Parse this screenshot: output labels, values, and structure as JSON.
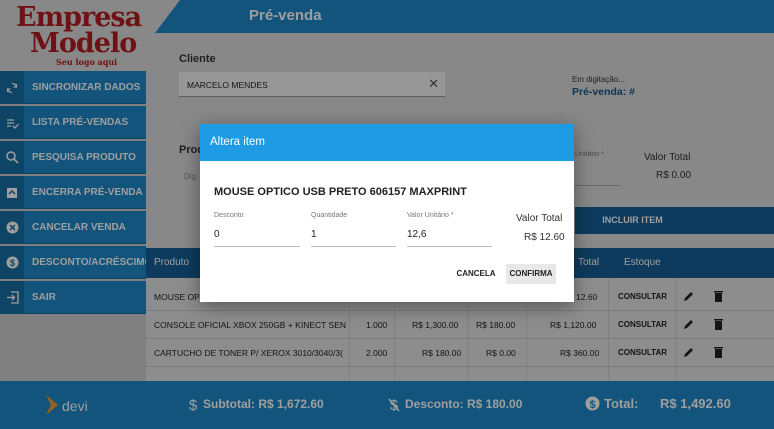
{
  "logo": {
    "line1": "Empresa",
    "line2": "Modelo",
    "tagline": "Seu logo aqui"
  },
  "header": {
    "title": "Pré-venda"
  },
  "sidebar": {
    "items": [
      {
        "label": "SINCRONIZAR DADOS",
        "icon": "sync-icon"
      },
      {
        "label": "LISTA PRÉ-VENDAS",
        "icon": "list-check-icon"
      },
      {
        "label": "PESQUISA PRODUTO",
        "icon": "search-icon"
      },
      {
        "label": "ENCERRA PRÉ-VENDA",
        "icon": "close-sale-icon"
      },
      {
        "label": "CANCELAR VENDA",
        "icon": "cancel-circle-icon"
      },
      {
        "label": "DESCONTO/ACRÉSCIMO",
        "icon": "dollar-circle-icon"
      },
      {
        "label": "SAIR",
        "icon": "exit-icon"
      }
    ]
  },
  "form": {
    "cliente_label": "Cliente",
    "cliente_value": "MARCELO MENDES",
    "status_text": "Em digitação...",
    "pre_venda_label": "Pré-venda: #",
    "produto_label": "Prod",
    "produto_placeholder": "Dig",
    "valor_unitario_label": "Unitário *",
    "valor_total_label": "Valor Total",
    "valor_total_value": "R$ 0.00",
    "incluir_label": "INCLUIR ITEM"
  },
  "table": {
    "headers": {
      "produto": "Produto",
      "total": "Total",
      "estoque": "Estoque"
    },
    "rows": [
      {
        "produto": "MOUSE OP",
        "qtd": "",
        "unit": "",
        "desc": "",
        "total": "12.60",
        "estoque": "CONSULTAR"
      },
      {
        "produto": "CONSOLE OFICIAL XBOX 250GB + KINECT SEN",
        "qtd": "1.000",
        "unit": "R$ 1,300.00",
        "desc": "R$ 180.00",
        "total": "R$ 1,120.00",
        "estoque": "CONSULTAR"
      },
      {
        "produto": "CARTUCHO DE TONER P/ XEROX 3010/3040/3(",
        "qtd": "2.000",
        "unit": "R$ 180.00",
        "desc": "R$ 0.00",
        "total": "R$ 360.00",
        "estoque": "CONSULTAR"
      }
    ]
  },
  "footer": {
    "brand": "devi",
    "subtotal": "Subtotal: R$ 1,672.60",
    "desconto": "Desconto: R$ 180.00",
    "total_label": "Total:",
    "total_value": "R$ 1,492.60"
  },
  "modal": {
    "title": "Altera item",
    "product": "MOUSE OPTICO USB PRETO 606157 MAXPRINT",
    "desconto_label": "Desconto",
    "desconto_value": "0",
    "quantidade_label": "Quantidade",
    "quantidade_value": "1",
    "valor_unitario_label": "Valor Unitário *",
    "valor_unitario_value": "12,6",
    "valor_total_label": "Valor Total",
    "valor_total_value": "R$ 12.60",
    "cancel_label": "CANCELA",
    "confirm_label": "CONFIRMA"
  },
  "colors": {
    "primary": "#1e88c8",
    "dark": "#175f96",
    "modal_header": "#1e9be4",
    "logo": "#b31e23"
  }
}
